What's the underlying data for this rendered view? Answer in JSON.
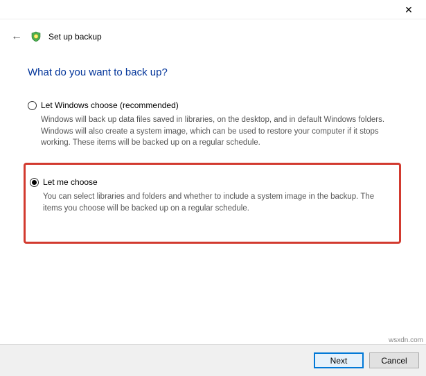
{
  "window": {
    "close_glyph": "✕"
  },
  "header": {
    "back_glyph": "←",
    "title": "Set up backup"
  },
  "main": {
    "heading": "What do you want to back up?",
    "options": [
      {
        "label": "Let Windows choose (recommended)",
        "desc": "Windows will back up data files saved in libraries, on the desktop, and in default Windows folders. Windows will also create a system image, which can be used to restore your computer if it stops working. These items will be backed up on a regular schedule.",
        "selected": false
      },
      {
        "label": "Let me choose",
        "desc": "You can select libraries and folders and whether to include a system image in the backup. The items you choose will be backed up on a regular schedule.",
        "selected": true
      }
    ]
  },
  "footer": {
    "next_label": "Next",
    "cancel_label": "Cancel"
  },
  "watermark": "wsxdn.com"
}
